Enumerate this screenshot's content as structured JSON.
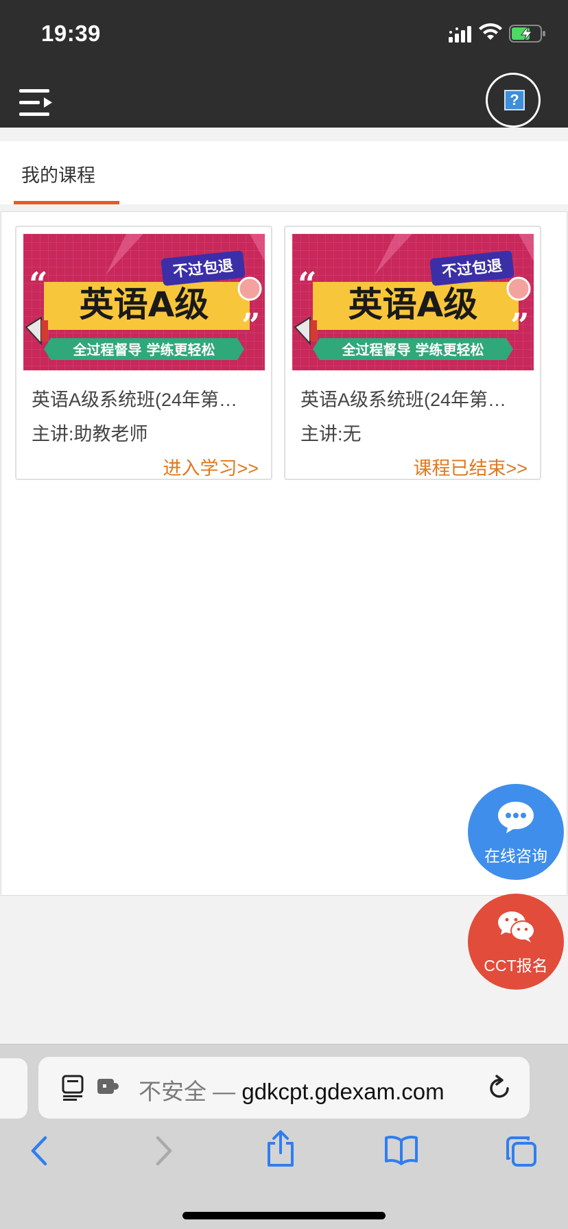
{
  "status_bar": {
    "time": "19:39"
  },
  "header": {
    "menu_icon": "menu-expand-icon",
    "help_icon": "help-icon"
  },
  "tabs": [
    {
      "label": "我的课程",
      "active": true
    }
  ],
  "courses": [
    {
      "banner": {
        "headline": "英语A级",
        "badge": "不过包退",
        "slogan": "全过程督导 学练更轻松"
      },
      "title": "英语A级系统班(24年第…",
      "teacher": "主讲:助教老师",
      "action": "进入学习>>"
    },
    {
      "banner": {
        "headline": "英语A级",
        "badge": "不过包退",
        "slogan": "全过程督导 学练更轻松"
      },
      "title": "英语A级系统班(24年第…",
      "teacher": "主讲:无",
      "action": "课程已结束>>"
    }
  ],
  "floating": {
    "consult": {
      "label": "在线咨询",
      "color": "#3f8eeb"
    },
    "signup": {
      "label": "CCT报名",
      "color": "#e24c3a"
    }
  },
  "browser": {
    "insecure_label": "不安全 — ",
    "domain": "gdkcpt.gdexam.com"
  },
  "colors": {
    "accent": "#e85a23",
    "action": "#e0781e",
    "header_bg": "#2e2e2e"
  }
}
